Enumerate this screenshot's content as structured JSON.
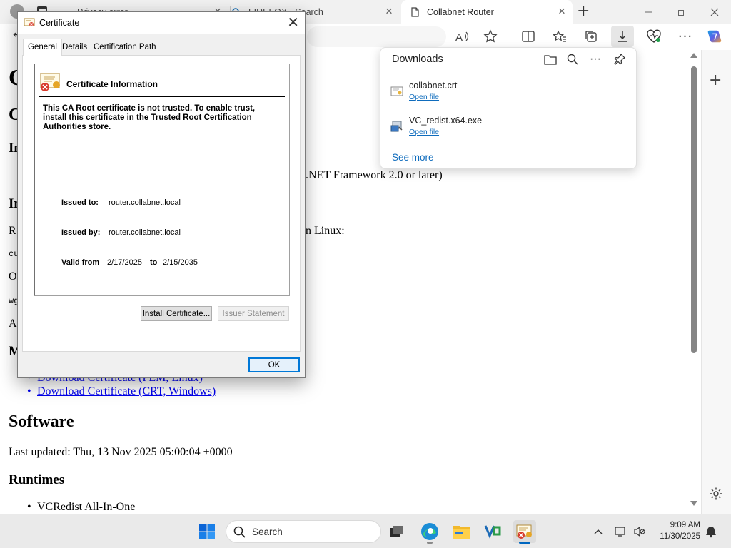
{
  "browser": {
    "tabs": [
      {
        "label": "Privacy error",
        "active": false
      },
      {
        "label": "FIREFOX - Search",
        "active": false
      },
      {
        "label": "Collabnet Router",
        "active": true
      }
    ],
    "new_tab_glyph": "+",
    "window_buttons": [
      "—",
      "❐",
      "✕"
    ],
    "toolbar_icons": [
      "read-aloud-icon",
      "favorite-star-icon",
      "split-screen-icon",
      "favorites-icon",
      "collections-icon",
      "downloads-icon",
      "browser-essentials-icon",
      "more-icon",
      "copilot-icon"
    ]
  },
  "page": {
    "heading_partial": "C",
    "subheading_partial": "C",
    "sec_in_1": "In",
    "framework_text": ".NET Framework 2.0 or later)",
    "sec_in_2": "In",
    "r_text": "R",
    "linux_text": "n Linux:",
    "cu_text": "cu",
    "o_text": "O",
    "wg_text": "wg",
    "a_text": "A",
    "m_text": "M",
    "link_pem": "Download Certificate (PEM, Linux)",
    "link_crt": "Download Certificate (CRT, Windows)",
    "software_heading": "Software",
    "last_updated": "Last updated: Thu, 13 Nov 2025 05:00:04 +0000",
    "runtimes_heading": "Runtimes",
    "runtime_item": "VCRedist All-In-One"
  },
  "downloads": {
    "title": "Downloads",
    "header_icons": [
      "folder-icon",
      "search-icon",
      "more-icon",
      "pin-icon"
    ],
    "items": [
      {
        "name": "collabnet.crt",
        "action": "Open file"
      },
      {
        "name": "VC_redist.x64.exe",
        "action": "Open file"
      }
    ],
    "see_more": "See more"
  },
  "certificate": {
    "window_title": "Certificate",
    "tabs": [
      "General",
      "Details",
      "Certification Path"
    ],
    "selected_tab": "General",
    "info_header": "Certificate Information",
    "warning": "This CA Root certificate is not trusted. To enable trust, install this certificate in the Trusted Root Certification Authorities store.",
    "issued_to_label": "Issued to:",
    "issued_to": "router.collabnet.local",
    "issued_by_label": "Issued by:",
    "issued_by": "router.collabnet.local",
    "valid_from_label": "Valid from",
    "valid_from": "2/17/2025",
    "to_label": "to",
    "valid_to": "2/15/2035",
    "install_button": "Install Certificate...",
    "issuer_statement_button": "Issuer Statement",
    "ok_button": "OK"
  },
  "taskbar": {
    "search_placeholder": "Search",
    "time": "9:09 AM",
    "date": "11/30/2025"
  },
  "colors": {
    "link": "#0000ee",
    "accent": "#0078d7",
    "downloads_link": "#0f6cbd"
  }
}
